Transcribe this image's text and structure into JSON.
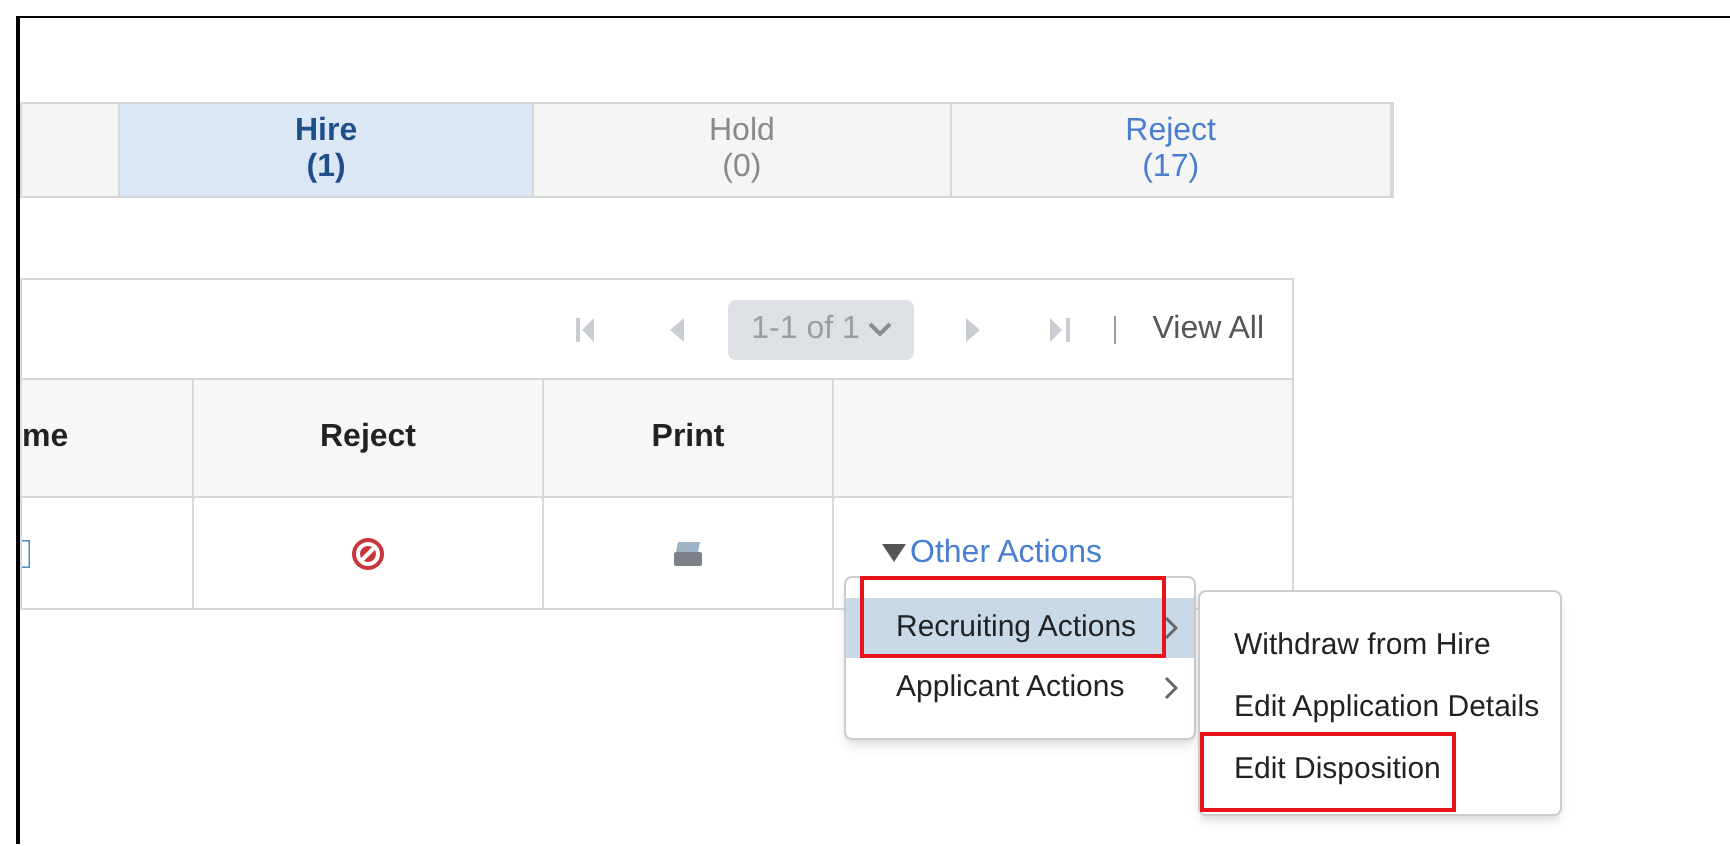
{
  "tabs": [
    {
      "label": "Hire",
      "count": "(1)",
      "selected": true,
      "disabled": false
    },
    {
      "label": "Hold",
      "count": "(0)",
      "selected": false,
      "disabled": true
    },
    {
      "label": "Reject",
      "count": "(17)",
      "selected": false,
      "disabled": false
    }
  ],
  "pagination": {
    "range": "1-1 of 1",
    "view_all": "View All"
  },
  "table": {
    "columns": [
      "me",
      "Reject",
      "Print"
    ],
    "row": {
      "actions_link": "Other Actions"
    }
  },
  "menu": [
    {
      "label": "Recruiting Actions",
      "selected": true,
      "annotated": true
    },
    {
      "label": "Applicant Actions",
      "selected": false,
      "annotated": false
    }
  ],
  "submenu": [
    {
      "label": "Withdraw from Hire",
      "annotated": false
    },
    {
      "label": "Edit Application Details",
      "annotated": false
    },
    {
      "label": "Edit Disposition",
      "annotated": true
    }
  ]
}
